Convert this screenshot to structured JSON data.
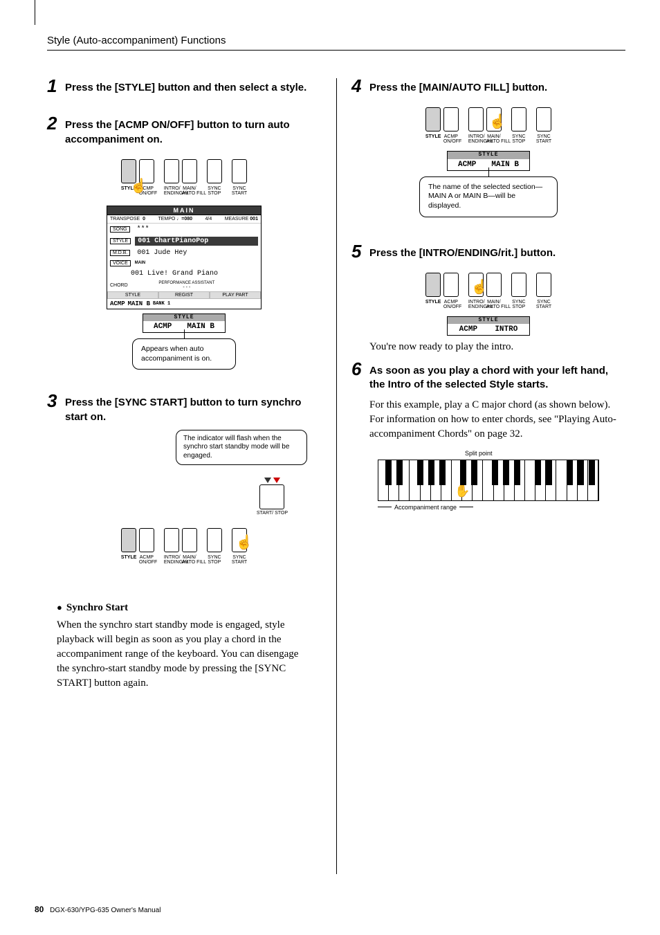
{
  "page_title": "Style (Auto-accompaniment) Functions",
  "steps": {
    "1": {
      "num": "1",
      "text": "Press the [STYLE] button and then select a style."
    },
    "2": {
      "num": "2",
      "text": "Press the [ACMP ON/OFF] button to turn auto accompaniment on."
    },
    "3": {
      "num": "3",
      "text": "Press the [SYNC START] button to turn synchro start on."
    },
    "4": {
      "num": "4",
      "text": "Press the [MAIN/AUTO FILL] button."
    },
    "5": {
      "num": "5",
      "text": "Press the [INTRO/ENDING/rit.] button."
    },
    "6": {
      "num": "6",
      "text": "As soon as you play a chord with your left hand, the Intro of the selected Style starts."
    }
  },
  "button_labels": {
    "style": "STYLE",
    "acmp": "ACMP\nON/OFF",
    "intro": "INTRO/\nENDING/rit.",
    "main": "MAIN/\nAUTO FILL",
    "syncstop": "SYNC\nSTOP",
    "syncstart": "SYNC\nSTART",
    "startstop": "START/\nSTOP"
  },
  "lcd_main": {
    "header": "MAIN",
    "transpose_label": "TRANSPOSE",
    "transpose_val": "0",
    "tempo_label": "TEMPO",
    "tempo_val": "♩=080",
    "timesig": "4/4",
    "measure_label": "MEASURE",
    "measure_val": "001",
    "song_tag": "SONG",
    "song_val": "***",
    "style_tag": "STYLE",
    "style_val": "001 ChartPianoPop",
    "mdb_tag": "M.D.B.",
    "mdb_val": "001 Jude Hey",
    "voice_tag": "VOICE",
    "voice_indicator": "MAIN",
    "voice_val": "001 Live! Grand Piano",
    "chord": "CHORD",
    "pa": "PERFORMANCE ASSISTANT",
    "pa_val": "- - -",
    "strip_style": "STYLE",
    "strip_regist": "REGIST",
    "strip_play": "PLAY PART",
    "acmp": "ACMP",
    "mainb": "MAIN B",
    "bank": "BANK 1"
  },
  "callout2": "Appears when auto accompaniment is on.",
  "callout3": "The indicator will flash when the synchro start standby mode will be engaged.",
  "callout4": "The name of the selected section—MAIN A or MAIN B—will be displayed.",
  "synchro_note": {
    "heading": "Synchro Start",
    "body": "When the synchro start standby mode is engaged, style playback will begin as soon as you play a chord in the accompaniment range of the keyboard. You can disengage the synchro-start standby mode by pressing the [SYNC START] button again."
  },
  "lcd_bar": {
    "head": "STYLE",
    "acmp": "ACMP",
    "mainb": "MAIN B",
    "intro": "INTRO"
  },
  "step5_body": "You're now ready to play the intro.",
  "step6_body": "For this example, play a C major chord (as shown below). For information on how to enter chords, see \"Playing Auto-accompaniment Chords\" on page 32.",
  "keyboard": {
    "split": "Split point",
    "range": "Accompaniment range"
  },
  "footer": {
    "page": "80",
    "manual": "DGX-630/YPG-635  Owner's Manual"
  }
}
